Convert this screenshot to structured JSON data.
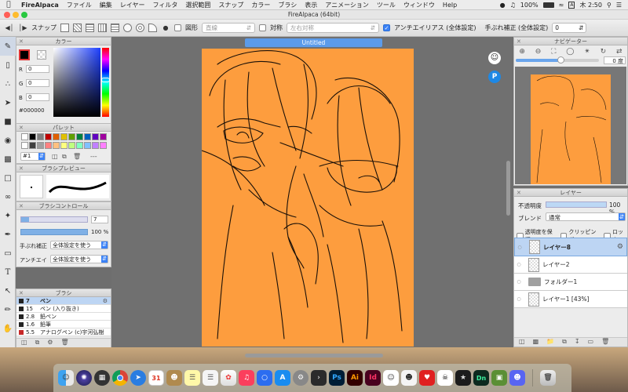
{
  "menubar": {
    "app_name": "FireAlpaca",
    "items": [
      "ファイル",
      "編集",
      "レイヤー",
      "フィルタ",
      "選択範囲",
      "スナップ",
      "カラー",
      "ブラシ",
      "表示",
      "アニメーション",
      "ツール",
      "ウィンドウ",
      "Help"
    ],
    "battery": "100%",
    "clock": "木 2:50"
  },
  "window": {
    "title": "FireAlpaca (64bit)"
  },
  "toolbar": {
    "snap_label": "スナップ",
    "shape_label": "図形",
    "shape_value": "直線",
    "symmetry_label": "対称",
    "symmetry_value": "左右対称",
    "antialias_label": "アンチエイリアス (全体設定)",
    "stabilizer_label": "手ぶれ補正 (全体設定)",
    "stabilizer_value": "0"
  },
  "color_panel": {
    "title": "カラー",
    "r_label": "R",
    "r": "0",
    "g_label": "G",
    "g": "0",
    "b_label": "B",
    "b": "0",
    "hex": "#000000"
  },
  "palette_panel": {
    "title": "パレット",
    "selected": "#1",
    "more": "---",
    "swatches": [
      "#ffffff",
      "#000000",
      "#7f7f7f",
      "#c00000",
      "#e06000",
      "#e0c000",
      "#60a000",
      "#008040",
      "#0060c0",
      "#6000c0",
      "#a000a0",
      "#ffffff",
      "#404040",
      "#a0a0a0",
      "#ff8080",
      "#ffc080",
      "#ffff80",
      "#c0ff80",
      "#80ffc0",
      "#80c0ff",
      "#c080ff",
      "#ff80ff"
    ]
  },
  "brush_preview": {
    "title": "ブラシプレビュー"
  },
  "brush_control": {
    "title": "ブラシコントロール",
    "size": "7",
    "opacity": "100 %",
    "stabilizer_label": "手ぶれ補正",
    "stabilizer_value": "全体設定を使う",
    "antialias_label": "アンチエイ",
    "antialias_value": "全体設定を使う"
  },
  "brush_panel": {
    "title": "ブラシ",
    "items": [
      {
        "size": "7",
        "name": "ペン",
        "color": "#222222",
        "selected": true
      },
      {
        "size": "15",
        "name": "ペン (入り抜き)",
        "color": "#222222",
        "selected": false
      },
      {
        "size": "2.8",
        "name": "鉛ペン",
        "color": "#222222",
        "selected": false
      },
      {
        "size": "1.6",
        "name": "鉛筆",
        "color": "#222222",
        "selected": false
      },
      {
        "size": "5.5",
        "name": "アナログペン (c)宇河弘樹",
        "color": "#c62828",
        "selected": false
      }
    ]
  },
  "document": {
    "tab_title": "Untitled",
    "canvas_color": "#fd9d3e"
  },
  "navigator": {
    "title": "ナビゲーター",
    "angle": "0 度"
  },
  "layer_panel": {
    "title": "レイヤー",
    "opacity_label": "不透明度",
    "opacity_value": "100 %",
    "opacity_fraction": 1.0,
    "blend_label": "ブレンド",
    "blend_value": "通常",
    "protect_label": "透明度を保護",
    "clipping_label": "クリッピング",
    "lock_label": "ロック",
    "layers": [
      {
        "name": "レイヤー8",
        "selected": true
      },
      {
        "name": "レイヤー2",
        "selected": false
      },
      {
        "name": "フォルダー1",
        "selected": false,
        "folder": true
      },
      {
        "name": "レイヤー1 [43%]",
        "selected": false
      }
    ]
  },
  "dock": {
    "photoshop": "Ps",
    "illustrator": "Ai",
    "indesign": "Id",
    "dimension": "Dn",
    "calendar_day": "31"
  },
  "colors": {
    "accent": "#5b9bea",
    "canvas": "#fd9d3e",
    "selection": "#bdd5f3"
  }
}
